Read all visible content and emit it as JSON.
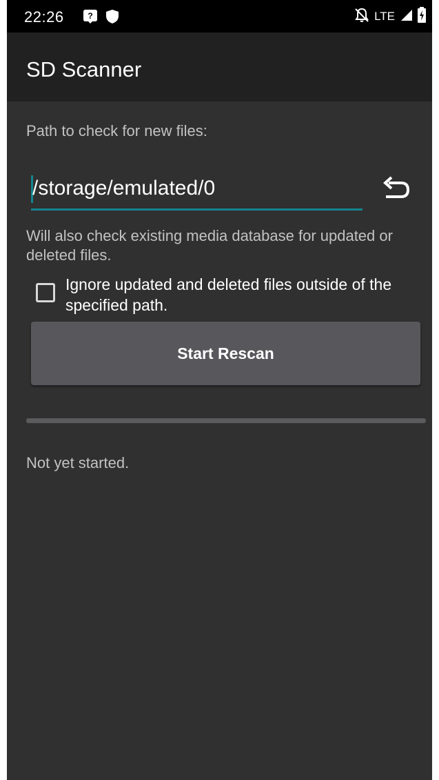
{
  "status_bar": {
    "time": "22:26",
    "network": "LTE",
    "icons": [
      "unknown-app-notification-icon",
      "shield-icon",
      "do-not-disturb-icon",
      "signal-icon",
      "battery-charging-icon"
    ]
  },
  "app_bar": {
    "title": "SD Scanner"
  },
  "form": {
    "path_label": "Path to check for new files:",
    "path_value": "/storage/emulated/0",
    "note": "Will also check existing media database for updated or deleted files.",
    "ignore_checkbox": {
      "label": "Ignore updated and deleted files outside of the specified path.",
      "checked": false
    },
    "rescan_button": "Start Rescan"
  },
  "progress": {
    "value": 0,
    "status": "Not yet started."
  },
  "colors": {
    "accent": "#15858f",
    "background": "#303030",
    "app_bar": "#212121",
    "button": "#58585c"
  }
}
